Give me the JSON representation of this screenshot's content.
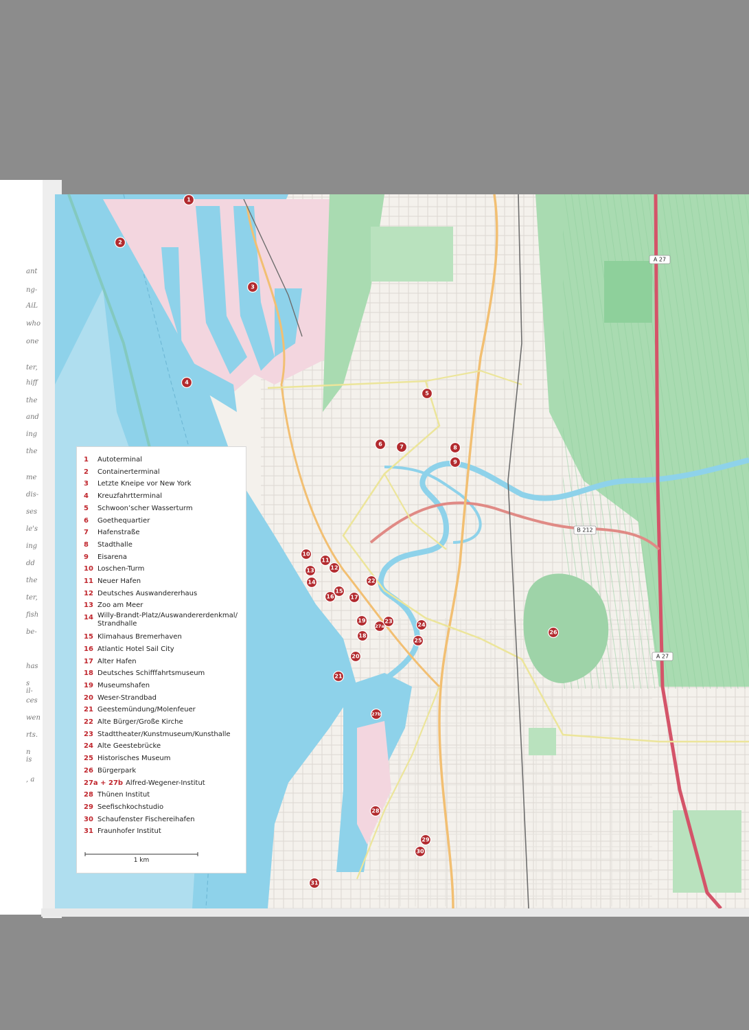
{
  "map": {
    "colors": {
      "background_scan": "#8c8c8c",
      "water": "#8ed2ea",
      "land": "#f4f1ec",
      "green": "#a9dbb1",
      "industrial": "#f3d6df",
      "highway": "#d45469",
      "main_road": "#f2bf72",
      "secondary_road": "#ece59a",
      "marker": "#b22a2e"
    },
    "road_labels": [
      "A 27",
      "B 212",
      "A 27"
    ],
    "markers": [
      "1",
      "2",
      "3",
      "4",
      "5",
      "6",
      "7",
      "8",
      "9",
      "10",
      "11",
      "12",
      "13",
      "14",
      "15",
      "16",
      "17",
      "18",
      "19",
      "27a",
      "23",
      "22",
      "24",
      "25",
      "20",
      "21",
      "27b",
      "26",
      "28",
      "29",
      "30",
      "31"
    ]
  },
  "legend": {
    "items": [
      {
        "num": "1",
        "label": "Autoterminal"
      },
      {
        "num": "2",
        "label": "Containerterminal"
      },
      {
        "num": "3",
        "label": "Letzte Kneipe vor New York"
      },
      {
        "num": "4",
        "label": "Kreuzfahrtterminal"
      },
      {
        "num": "5",
        "label": "Schwoon’scher Wasserturm"
      },
      {
        "num": "6",
        "label": "Goethequartier"
      },
      {
        "num": "7",
        "label": "Hafenstraße"
      },
      {
        "num": "8",
        "label": "Stadthalle"
      },
      {
        "num": "9",
        "label": "Eisarena"
      },
      {
        "num": "10",
        "label": "Loschen-Turm"
      },
      {
        "num": "11",
        "label": "Neuer Hafen"
      },
      {
        "num": "12",
        "label": "Deutsches Auswandererhaus"
      },
      {
        "num": "13",
        "label": "Zoo am Meer"
      },
      {
        "num": "14",
        "label": "Willy-Brandt-Platz/Auswandererdenkmal/ Strandhalle"
      },
      {
        "num": "15",
        "label": "Klimahaus Bremerhaven"
      },
      {
        "num": "16",
        "label": "Atlantic Hotel Sail City"
      },
      {
        "num": "17",
        "label": "Alter Hafen"
      },
      {
        "num": "18",
        "label": "Deutsches Schifffahrtsmuseum"
      },
      {
        "num": "19",
        "label": "Museumshafen"
      },
      {
        "num": "20",
        "label": "Weser-Strandbad"
      },
      {
        "num": "21",
        "label": "Geestemündung/Molenfeuer"
      },
      {
        "num": "22",
        "label": "Alte Bürger/Große Kirche"
      },
      {
        "num": "23",
        "label": "Stadttheater/Kunstmuseum/Kunsthalle"
      },
      {
        "num": "24",
        "label": "Alte Geestebrücke"
      },
      {
        "num": "25",
        "label": "Historisches Museum"
      },
      {
        "num": "26",
        "label": "Bürgerpark"
      },
      {
        "num": "27a + 27b",
        "label": "Alfred-Wegener-Institut"
      },
      {
        "num": "28",
        "label": "Thünen Institut"
      },
      {
        "num": "29",
        "label": "Seefischkochstudio"
      },
      {
        "num": "30",
        "label": "Schaufenster Fischereihafen"
      },
      {
        "num": "31",
        "label": "Fraunhofer Institut"
      }
    ],
    "scale_label": "1 km"
  },
  "left_page_fragments": [
    "ant",
    "ng-",
    "AiL",
    "who",
    "one",
    "ter,",
    "hiff",
    "the",
    "and",
    "ing",
    "the",
    "me",
    "dis-",
    "ses",
    "le's",
    "ing",
    "dd",
    "the",
    "ter,",
    "fish",
    "be-",
    "has",
    "s il-",
    "ces",
    "wen",
    "rts.",
    "n is",
    ", a"
  ]
}
